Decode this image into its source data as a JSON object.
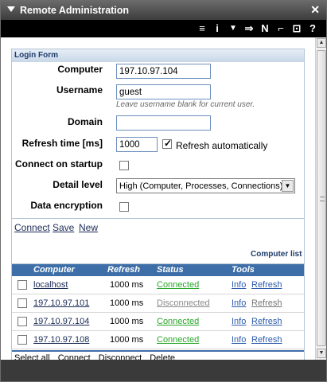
{
  "window": {
    "title": "Remote Administration",
    "close_glyph": "✕"
  },
  "toolbar": {
    "icons": [
      {
        "name": "list-view-icon",
        "glyph": "≡"
      },
      {
        "name": "info-icon",
        "glyph": "i"
      },
      {
        "name": "filter-icon",
        "glyph": "▼"
      },
      {
        "name": "forward-icon",
        "glyph": "⇒"
      },
      {
        "name": "network-icon",
        "glyph": "N"
      },
      {
        "name": "key-icon",
        "glyph": "⌐"
      },
      {
        "name": "connect-plug-icon",
        "glyph": "⊡"
      },
      {
        "name": "help-icon",
        "glyph": "?"
      }
    ]
  },
  "login_form": {
    "title": "Login Form",
    "computer_label": "Computer",
    "computer_value": "197.10.97.104",
    "username_label": "Username",
    "username_value": "guest",
    "username_hint": "Leave username blank for current user.",
    "domain_label": "Domain",
    "domain_value": "",
    "refresh_label": "Refresh time [ms]",
    "refresh_value": "1000",
    "refresh_auto_label": "Refresh automatically",
    "refresh_auto_checked": true,
    "connect_startup_label": "Connect on startup",
    "connect_startup_checked": false,
    "detail_label": "Detail level",
    "detail_value": "High (Computer, Processes, Connections)",
    "encryption_label": "Data encryption",
    "encryption_checked": false,
    "actions": {
      "connect": "Connect",
      "save": "Save",
      "new": "New"
    }
  },
  "computer_list": {
    "title": "Computer list",
    "columns": {
      "computer": "Computer",
      "refresh": "Refresh",
      "status": "Status",
      "tools": "Tools"
    },
    "rows": [
      {
        "computer": "localhost",
        "refresh": "1000 ms",
        "status": "Connected",
        "info": "Info",
        "refresh_link": "Refresh"
      },
      {
        "computer": "197.10.97.101",
        "refresh": "1000 ms",
        "status": "Disconnected",
        "info": "Info",
        "refresh_link": "Refresh"
      },
      {
        "computer": "197.10.97.104",
        "refresh": "1000 ms",
        "status": "Connected",
        "info": "Info",
        "refresh_link": "Refresh"
      },
      {
        "computer": "197.10.97.108",
        "refresh": "1000 ms",
        "status": "Connected",
        "info": "Info",
        "refresh_link": "Refresh"
      }
    ],
    "footer": {
      "select_all": "Select all",
      "connect": "Connect",
      "disconnect": "Disconnect",
      "delete": "Delete"
    }
  },
  "colors": {
    "header_blue": "#3e6ea8",
    "connected_green": "#2aa62a",
    "disconnected_gray": "#8a8a8a"
  }
}
